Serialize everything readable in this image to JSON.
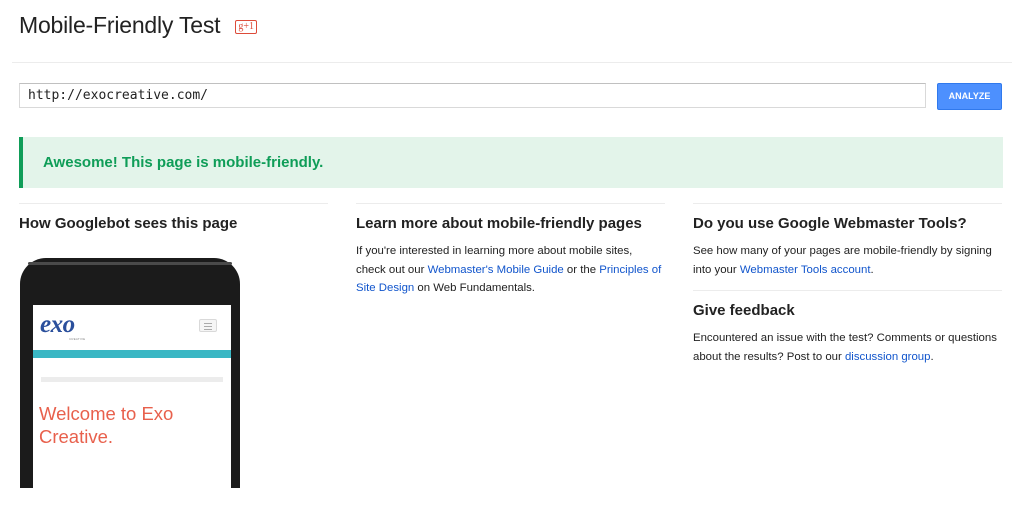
{
  "header": {
    "title": "Mobile-Friendly Test",
    "gplus_label": "g+1"
  },
  "search": {
    "url_value": "http://exocreative.com/",
    "analyze_label": "ANALYZE"
  },
  "result": {
    "message": "Awesome! This page is mobile-friendly."
  },
  "googlebot": {
    "heading": "How Googlebot sees this page",
    "preview": {
      "logo": "exo",
      "logo_sub": "CREATIVE",
      "welcome": "Welcome to Exo Creative."
    }
  },
  "learn": {
    "heading": "Learn more about mobile-friendly pages",
    "text_1": "If you're interested in learning more about mobile sites, check out our ",
    "link_1": "Webmaster's Mobile Guide",
    "text_2": " or the ",
    "link_2": "Principles of Site Design",
    "text_3": " on Web Fundamentals."
  },
  "webmaster": {
    "heading": "Do you use Google Webmaster Tools?",
    "text_1": "See how many of your pages are mobile-friendly by signing into your ",
    "link_1": "Webmaster Tools account",
    "text_2": "."
  },
  "feedback": {
    "heading": "Give feedback",
    "text_1": "Encountered an issue with the test? Comments or questions about the results? Post to our ",
    "link_1": "discussion group",
    "text_2": "."
  },
  "colors": {
    "accent": "#4d90fe",
    "success": "#0f9d58",
    "link": "#1155cc",
    "welcome": "#e8604c",
    "teal": "#3ab7c4"
  }
}
